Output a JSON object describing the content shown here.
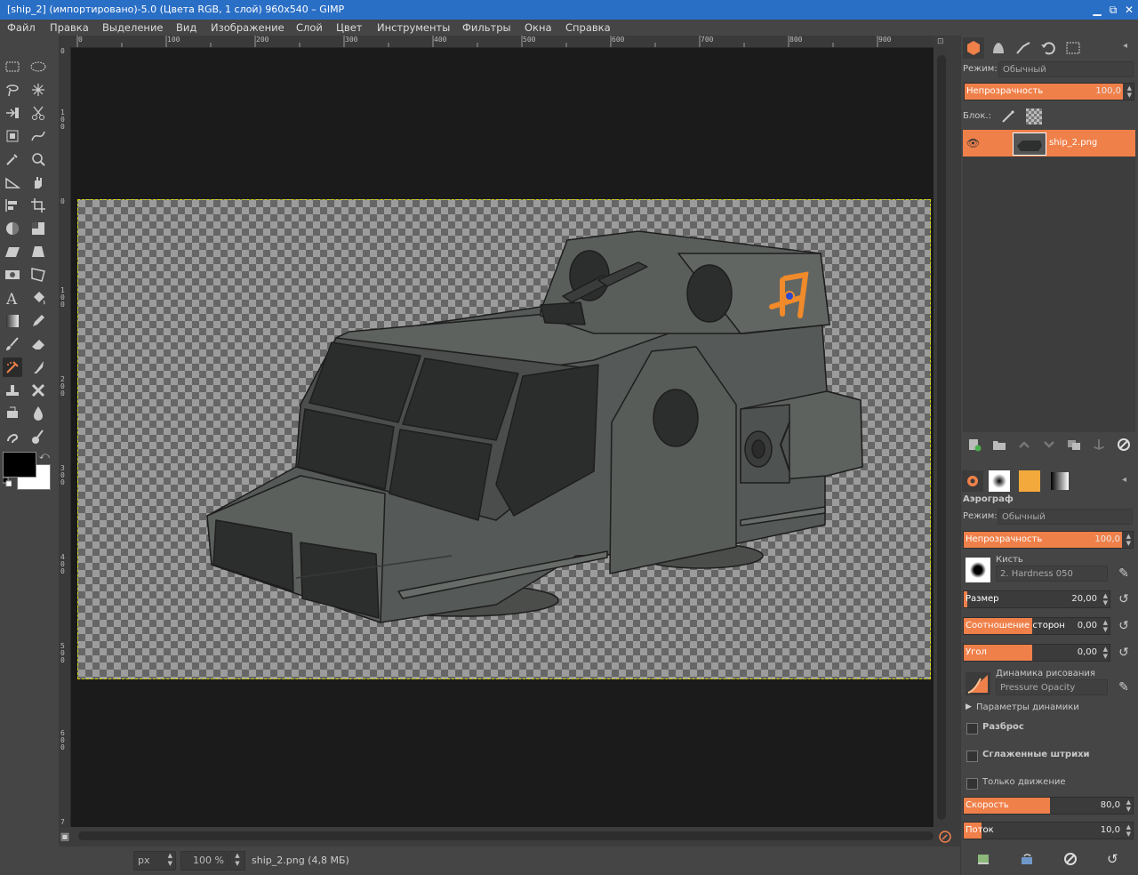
{
  "window": {
    "title": "[ship_2] (импортировано)-5.0 (Цвета RGB, 1 слой) 960x540 – GIMP",
    "minimize": "▁",
    "maximize": "⧉",
    "close": "✕"
  },
  "menu": [
    "Файл",
    "Правка",
    "Выделение",
    "Вид",
    "Изображение",
    "Слой",
    "Цвет",
    "Инструменты",
    "Фильтры",
    "Окна",
    "Справка"
  ],
  "rulers": {
    "horizontal": [
      "0",
      "100",
      "200",
      "300",
      "400",
      "500",
      "600",
      "700",
      "800",
      "900"
    ],
    "vertical": [
      "0",
      "1 0 0",
      "2 0 0",
      "3 0 0",
      "4 0 0",
      "5 0 0",
      "6 0 0",
      "7"
    ]
  },
  "colors": {
    "foreground": "#000000",
    "background": "#ffffff",
    "accent": "#f0804a"
  },
  "status": {
    "unit": "px",
    "zoom": "100 %",
    "file_info": "ship_2.png (4,8 МБ)"
  },
  "layers_panel": {
    "mode_label": "Режим:",
    "mode_value": "Обычный",
    "opacity_label": "Непрозрачность",
    "opacity_value": "100,0",
    "lock_label": "Блок.:",
    "layer_name": "ship_2.png"
  },
  "tool_options": {
    "tool_name": "Аэрограф",
    "mode_label": "Режим:",
    "mode_value": "Обычный",
    "opacity_label": "Непрозрачность",
    "opacity_value": "100,0",
    "brush_label": "Кисть",
    "brush_value": "2. Hardness 050",
    "size_label": "Размер",
    "size_value": "20,00",
    "aspect_label": "Соотношение сторон",
    "aspect_value": "0,00",
    "angle_label": "Угол",
    "angle_value": "0,00",
    "dynamics_label": "Динамика рисования",
    "dynamics_value": "Pressure Opacity",
    "dynamics_params": "Параметры динамики",
    "scatter": "Разброс",
    "smooth": "Сглаженные штрихи",
    "motion_only": "Только движение",
    "rate_label": "Скорость",
    "rate_value": "80,0",
    "flow_label": "Поток",
    "flow_value": "10,0"
  }
}
